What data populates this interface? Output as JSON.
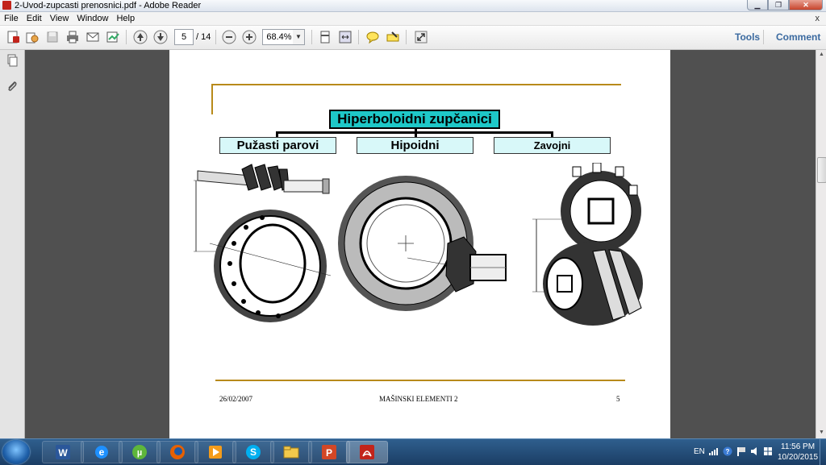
{
  "window": {
    "title": "2-Uvod-zupcasti prenosnici.pdf - Adobe Reader",
    "accent": "#c2241b"
  },
  "menu": {
    "items": [
      "File",
      "Edit",
      "View",
      "Window",
      "Help"
    ],
    "close": "x"
  },
  "toolbar": {
    "page_current": "5",
    "page_total": "/ 14",
    "zoom": "68.4%",
    "tools_label": "Tools",
    "comment_label": "Comment",
    "icons": [
      "create-pdf-icon",
      "open-icon",
      "save-icon",
      "print-icon",
      "email-icon",
      "sign-icon",
      "previous-page-icon",
      "next-page-icon",
      "zoom-out-icon",
      "zoom-in-icon",
      "fit-page-icon",
      "fit-width-icon",
      "sticky-note-icon",
      "highlight-icon",
      "full-screen-icon"
    ]
  },
  "slide": {
    "title": "Hiperboloidni zupčanici",
    "categories": [
      "Pužasti parovi",
      "Hipoidni",
      "Zavojni"
    ],
    "footer_date": "26/02/2007",
    "footer_course": "MAŠINSKI ELEMENTI 2",
    "footer_page": "5",
    "title_color": "#1ec8c8",
    "box_color": "#d8f8f9",
    "line_color": "#b88a1a"
  },
  "taskbar": {
    "apps": [
      "word-icon",
      "internet-explorer-icon",
      "utorrent-icon",
      "firefox-icon",
      "media-player-icon",
      "skype-icon",
      "file-explorer-icon",
      "powerpoint-icon",
      "adobe-reader-icon"
    ],
    "language": "EN",
    "time": "11:56 PM",
    "date": "10/20/2015"
  }
}
